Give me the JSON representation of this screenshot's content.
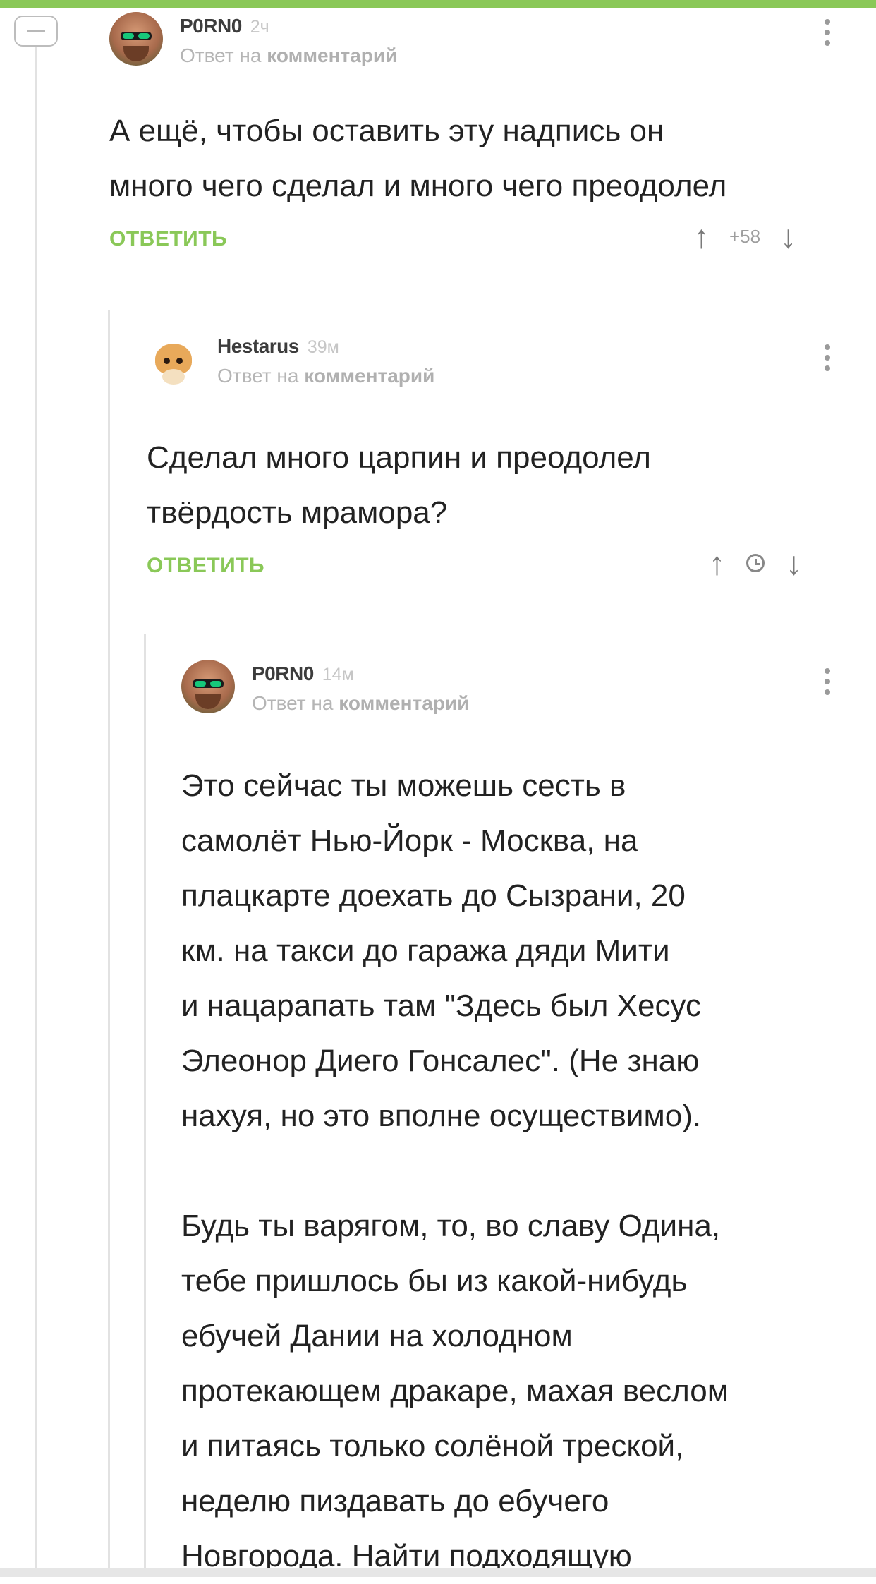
{
  "comments": [
    {
      "author": "P0RN0",
      "time": "2ч",
      "reply_prefix": "Ответ на",
      "reply_target": "комментарий",
      "lines": [
        "А ещё, чтобы оставить эту надпись он",
        "много чего сделал и много чего преодолел"
      ],
      "reply_label": "ОТВЕТИТЬ",
      "rating": "+58"
    },
    {
      "author": "Hestarus",
      "time": "39м",
      "reply_prefix": "Ответ на",
      "reply_target": "комментарий",
      "lines": [
        "Сделал много царпин и преодолел",
        "твёрдость мрамора?"
      ],
      "reply_label": "ОТВЕТИТЬ",
      "rating_icon": "clock-icon"
    },
    {
      "author": "P0RN0",
      "time": "14м",
      "reply_prefix": "Ответ на",
      "reply_target": "комментарий",
      "lines": [
        "Это сейчас ты можешь сесть в",
        "самолёт Нью-Йорк - Москва, на",
        "плацкарте доехать до Сызрани, 20",
        "км. на такси до гаража дяди Мити",
        "и нацарапать там \"Здесь был Хесус",
        "Элеонор Диего Гонсалес\". (Не знаю",
        "нахуя, но это вполне осуществимо).",
        "",
        "Будь ты варягом, то, во славу Одина,",
        "тебе пришлось бы из какой-нибудь",
        "ебучей Дании на холодном",
        "протекающем дракаре, махая веслом",
        "и питаясь только солёной треской,",
        "неделю пиздавать до ебучего",
        "Новгорода. Найти подходящую"
      ]
    }
  ],
  "icons": {
    "collapse": "minus-icon",
    "menu": "more-vertical-icon",
    "upvote": "arrow-up-icon",
    "downvote": "arrow-down-icon"
  },
  "colors": {
    "accent": "#8ac858",
    "thread_line": "#e2e2e2"
  }
}
